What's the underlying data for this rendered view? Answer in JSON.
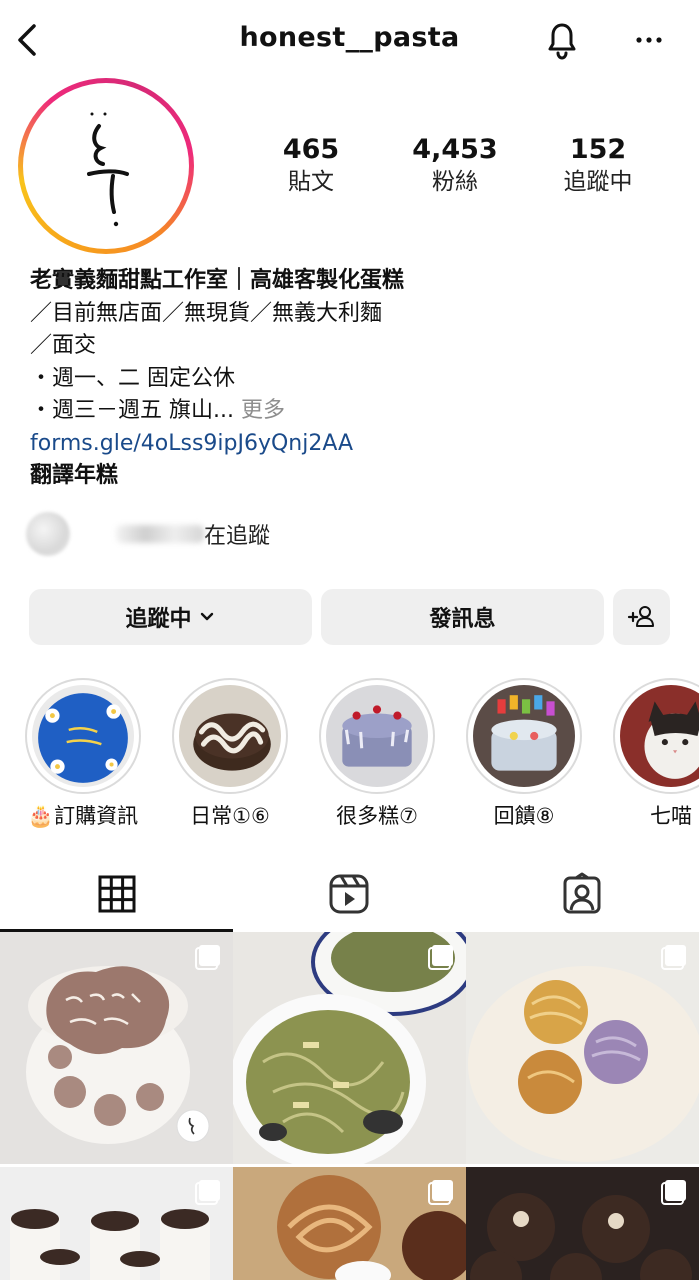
{
  "header": {
    "username": "honest__pasta",
    "back_icon": "chevron-left-icon",
    "bell_icon": "bell-icon",
    "more_icon": "more-horizontal-icon"
  },
  "stats": [
    {
      "value": "465",
      "label": "貼文"
    },
    {
      "value": "4,453",
      "label": "粉絲"
    },
    {
      "value": "152",
      "label": "追蹤中"
    }
  ],
  "bio": {
    "name": "老實義麵甜點工作室｜高雄客製化蛋糕",
    "lines": [
      "／目前無店面／無現貨／無義大利麵",
      "／面交",
      "・週一、二 固定公休",
      "・週三－週五 旗山..."
    ],
    "more_label": "更多",
    "link": "forms.gle/4oLss9ipJ6yQnj2AA",
    "translate_label": "翻譯年糕"
  },
  "followed_by": {
    "text": "在追蹤"
  },
  "buttons": {
    "following_label": "追蹤中",
    "message_label": "發訊息",
    "add_user_icon": "add-user-icon"
  },
  "highlights": [
    {
      "label": "🎂訂購資訊"
    },
    {
      "label": "日常①⑥"
    },
    {
      "label": "很多糕⑦"
    },
    {
      "label": "回饋⑧"
    },
    {
      "label": "七喵"
    }
  ],
  "tabs": [
    {
      "icon": "grid-icon",
      "active": true
    },
    {
      "icon": "reels-icon",
      "active": false
    },
    {
      "icon": "tagged-icon",
      "active": false
    }
  ],
  "colors": {
    "link": "#1a4a8a",
    "button_bg": "#efefef",
    "muted": "#8e8e8e"
  }
}
